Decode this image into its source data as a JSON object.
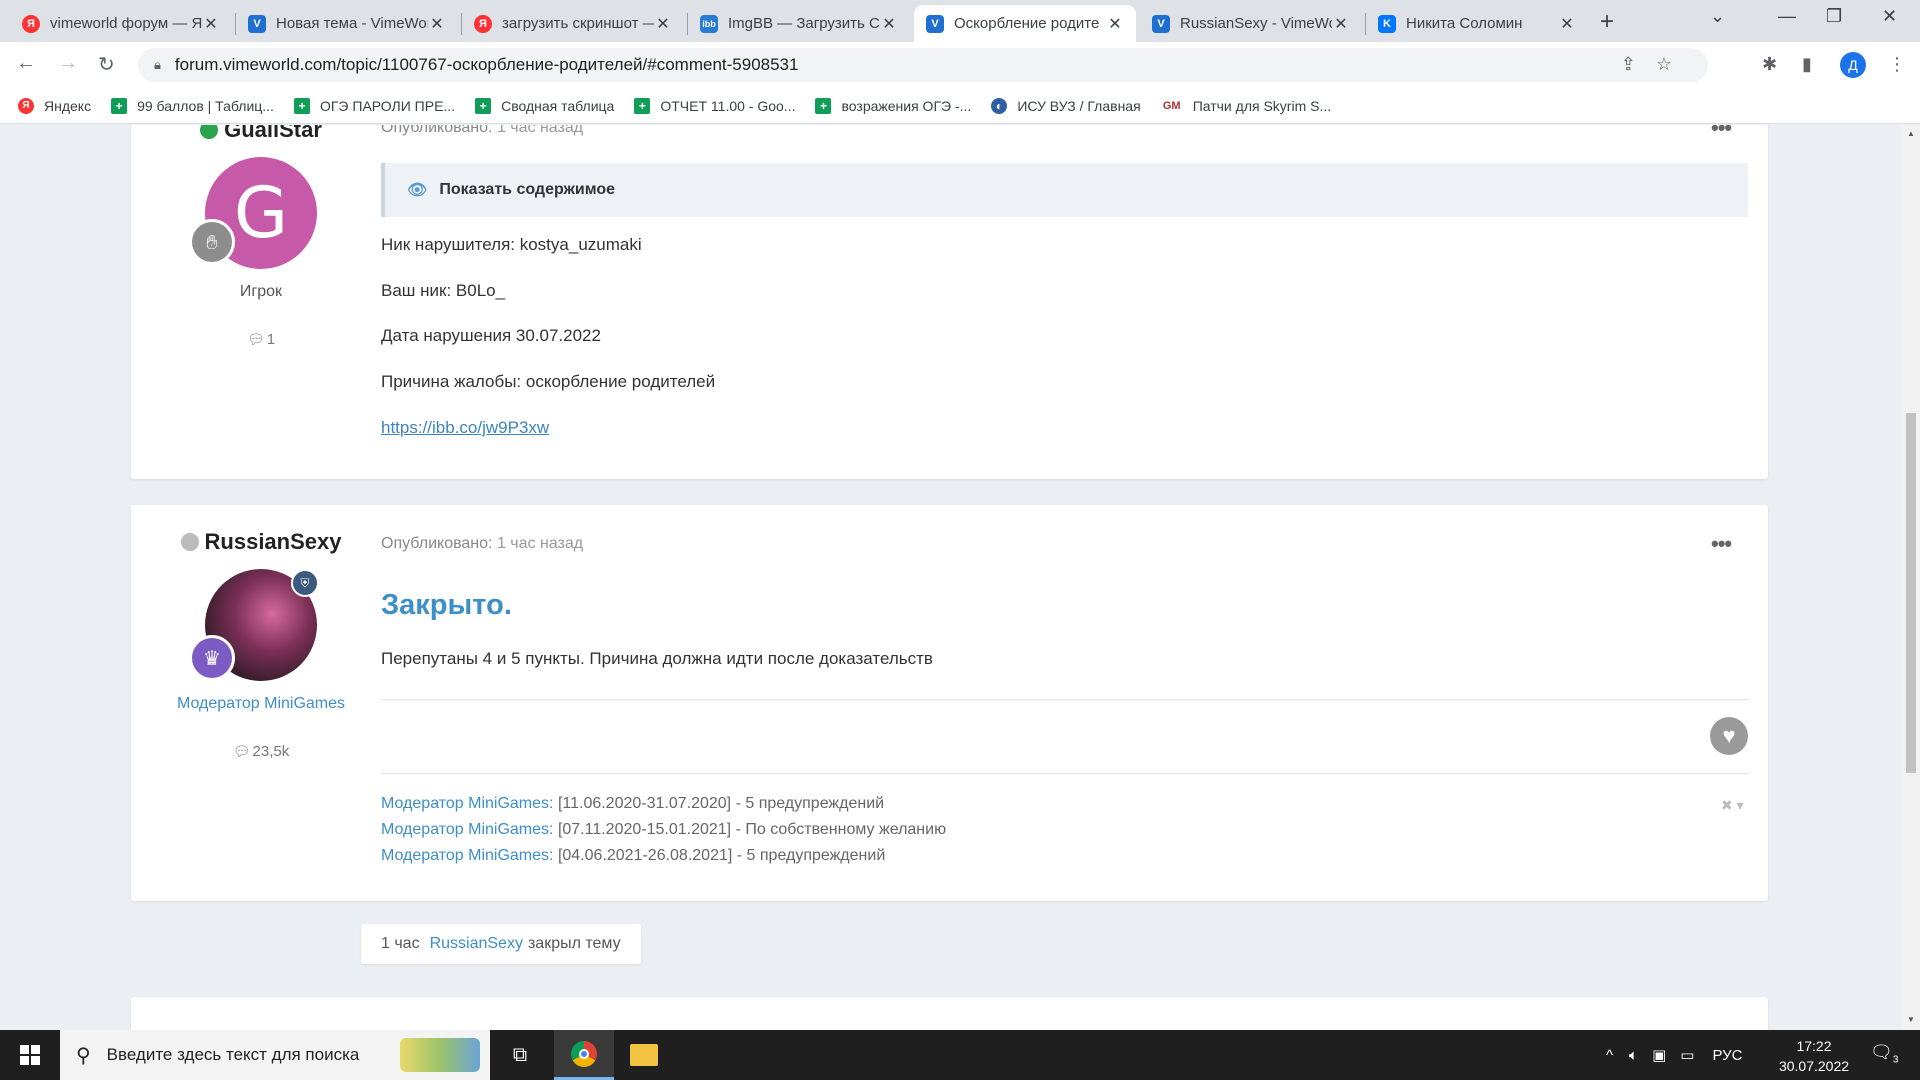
{
  "browser": {
    "tabs": [
      {
        "title": "vimeworld форум — Я",
        "icon": "yandex-icon",
        "active": false
      },
      {
        "title": "Новая тема - VimeWorld",
        "icon": "vimeworld-icon",
        "active": false
      },
      {
        "title": "загрузить скриншот — Я",
        "icon": "yandex-icon",
        "active": false
      },
      {
        "title": "ImgBB — Загрузить С",
        "icon": "imgbb-icon",
        "active": false
      },
      {
        "title": "Оскорбление родите",
        "icon": "vimeworld-icon",
        "active": true
      },
      {
        "title": "RussianSexy - VimeWo",
        "icon": "vimeworld-icon",
        "active": false
      },
      {
        "title": "Никита Соломин",
        "icon": "vk-icon",
        "active": false
      }
    ],
    "url": "forum.vimeworld.com/topic/1100767-оскорбление-родителей/#comment-5908531",
    "profile_initial": "Д",
    "bookmarks": [
      {
        "label": "Яндекс",
        "icon": "yandex-icon"
      },
      {
        "label": "99 баллов | Таблиц...",
        "icon": "sheets-icon"
      },
      {
        "label": "ОГЭ ПАРОЛИ ПРЕ...",
        "icon": "sheets-icon"
      },
      {
        "label": "Сводная таблица",
        "icon": "sheets-icon"
      },
      {
        "label": "ОТЧЕТ 11.00 - Goo...",
        "icon": "sheets-icon"
      },
      {
        "label": "возражения ОГЭ -...",
        "icon": "sheets-icon"
      },
      {
        "label": "ИСУ ВУЗ / Главная",
        "icon": "isu-icon"
      },
      {
        "label": "Патчи для Skyrim S...",
        "icon": "gm-icon"
      }
    ]
  },
  "posts": [
    {
      "author": "GualiStar",
      "online": true,
      "avatar_letter": "G",
      "role": "Игрок",
      "post_count": "1",
      "published_label": "Опубликовано:",
      "published_time": "1 час назад",
      "spoiler_label": "Показать содержимое",
      "lines": [
        "Ник нарушителя: kostya_uzumaki",
        "Ваш ник: B0Lo_",
        "Дата нарушения 30.07.2022",
        "Причина жалобы: оскорбление родителей"
      ],
      "link": "https://ibb.co/jw9P3xw"
    },
    {
      "author": "RussianSexy",
      "online": false,
      "role": "Модератор MiniGames",
      "post_count": "23,5k",
      "published_label": "Опубликовано:",
      "published_time": "1 час назад",
      "title": "Закрыто.",
      "text": "Перепутаны 4 и 5 пункты. Причина должна идти после доказательств",
      "history": [
        {
          "role": "Модератор MiniGames:",
          "detail": "[11.06.2020-31.07.2020] - 5 предупреждений"
        },
        {
          "role": "Модератор MiniGames:",
          "detail": "[07.11.2020-15.01.2021] - По собственному желанию"
        },
        {
          "role": "Модератор MiniGames:",
          "detail": "[04.06.2021-26.08.2021] - 5 предупреждений"
        }
      ]
    }
  ],
  "event": {
    "time": "1 час",
    "user": "RussianSexy",
    "action": "закрыл тему"
  },
  "taskbar": {
    "search_placeholder": "Введите здесь текст для поиска",
    "language": "РУС",
    "time": "17:22",
    "date": "30.07.2022",
    "notifications": "3"
  }
}
